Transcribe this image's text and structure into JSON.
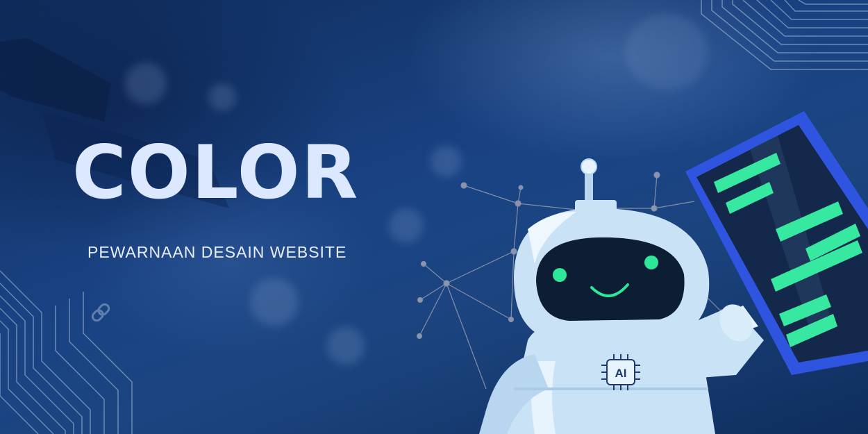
{
  "hero": {
    "title": "COLOR",
    "subtitle": "PEWARNAAN DESAIN WEBSITE"
  },
  "robot": {
    "chest_badge": "AI"
  },
  "colors": {
    "background": "#1a4384",
    "title": "#dce8ff",
    "robot_body": "#c9e2f5",
    "robot_visor": "#0d1d33",
    "robot_eyes": "#2ee89a",
    "tablet_frame": "#2f55e0",
    "tablet_lines": "#37e8a0"
  },
  "icons": {
    "link": "link-icon",
    "network": "network-graph",
    "circuit": "circuit-lines"
  }
}
